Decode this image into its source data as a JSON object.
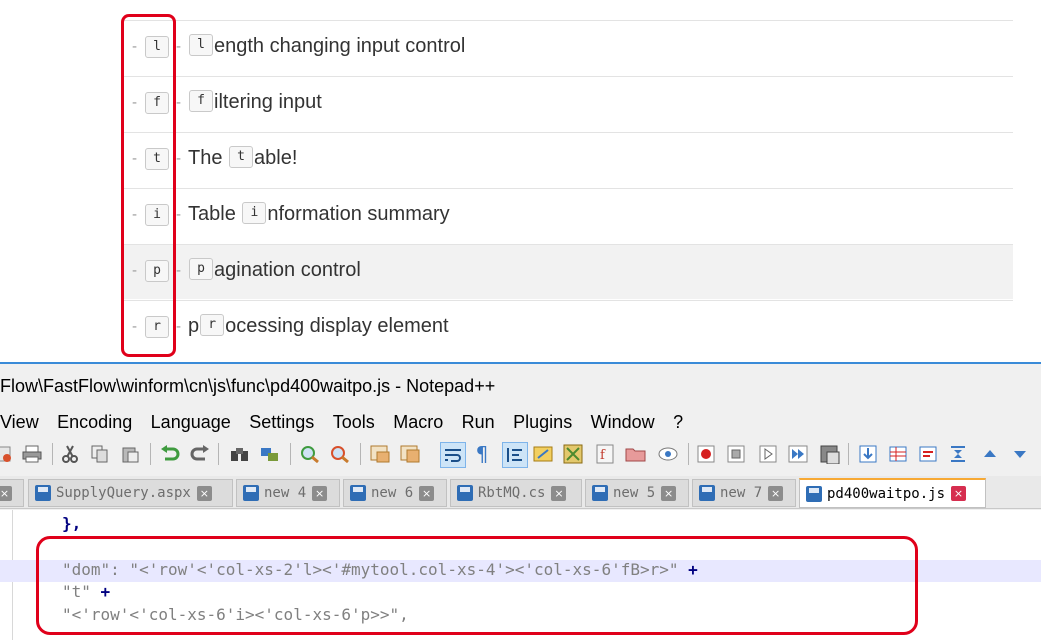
{
  "doc_table": {
    "rows": [
      {
        "key": "l",
        "prefix": "",
        "key_inline": "l",
        "rest": "ength changing input control",
        "shaded": false
      },
      {
        "key": "f",
        "prefix": "",
        "key_inline": "f",
        "rest": "iltering input",
        "shaded": false
      },
      {
        "key": "t",
        "prefix": "The ",
        "key_inline": "t",
        "rest": "able!",
        "shaded": false
      },
      {
        "key": "i",
        "prefix": "Table ",
        "key_inline": "i",
        "rest": "nformation summary",
        "shaded": false
      },
      {
        "key": "p",
        "prefix": "",
        "key_inline": "p",
        "rest": "agination control",
        "shaded": true
      },
      {
        "key": "r",
        "prefix": "p",
        "key_inline": "r",
        "rest": "ocessing display element",
        "shaded": false
      }
    ],
    "dash": "-"
  },
  "notepad": {
    "title": "Flow\\FastFlow\\winform\\cn\\js\\func\\pd400waitpo.js - Notepad++",
    "menu": [
      "View",
      "Encoding",
      "Language",
      "Settings",
      "Tools",
      "Macro",
      "Run",
      "Plugins",
      "Window",
      "?"
    ],
    "tabs": [
      {
        "label": "",
        "active": false
      },
      {
        "label": "SupplyQuery.aspx",
        "active": false
      },
      {
        "label": "new 4",
        "active": false
      },
      {
        "label": "new 6",
        "active": false
      },
      {
        "label": "RbtMQ.cs",
        "active": false
      },
      {
        "label": "new 5",
        "active": false
      },
      {
        "label": "new 7",
        "active": false
      },
      {
        "label": "pd400waitpo.js",
        "active": true
      }
    ],
    "code": {
      "line1": "},",
      "line3_str": "\"dom\": \"<'row'<'col-xs-2'l><'#mytool.col-xs-4'><'col-xs-6'fB>r>\"",
      "line3_op": "+",
      "line4_str": "\"t\"",
      "line4_op": "+",
      "line5_str": "\"<'row'<'col-xs-6'i><'col-xs-6'p>>\",",
      "close_glyph": "×"
    }
  },
  "colors": {
    "highlight_box": "#e0001a",
    "current_line": "#e8e8ff",
    "active_tab_accent": "#f7a934"
  }
}
